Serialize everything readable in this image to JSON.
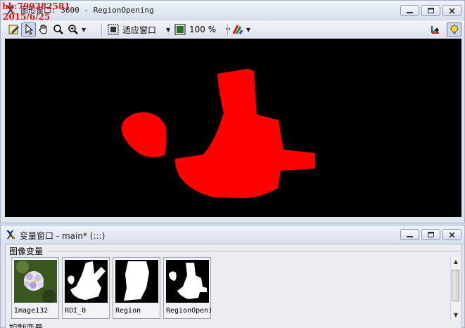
{
  "watermark": {
    "line1": "hb:799382581",
    "line2": "2015/6/25"
  },
  "graphics_window": {
    "title": "图形窗口: 3600 - RegionOpening",
    "toolbar": {
      "zoom_mode": "适应窗口",
      "zoom_percent": "100 %"
    }
  },
  "variable_window": {
    "title": "变量窗口 - main* (:::)",
    "section_label": "图像变量",
    "thumbnails": [
      {
        "label": "Image132",
        "kind": "photo"
      },
      {
        "label": "ROI_0",
        "kind": "region"
      },
      {
        "label": "Region",
        "kind": "region"
      },
      {
        "label": "RegionOpening",
        "kind": "region"
      }
    ],
    "next_section_label": "控制变量"
  },
  "colors": {
    "region": "#ff0000",
    "canvas_bg": "#000000",
    "accent": "#e01818"
  }
}
